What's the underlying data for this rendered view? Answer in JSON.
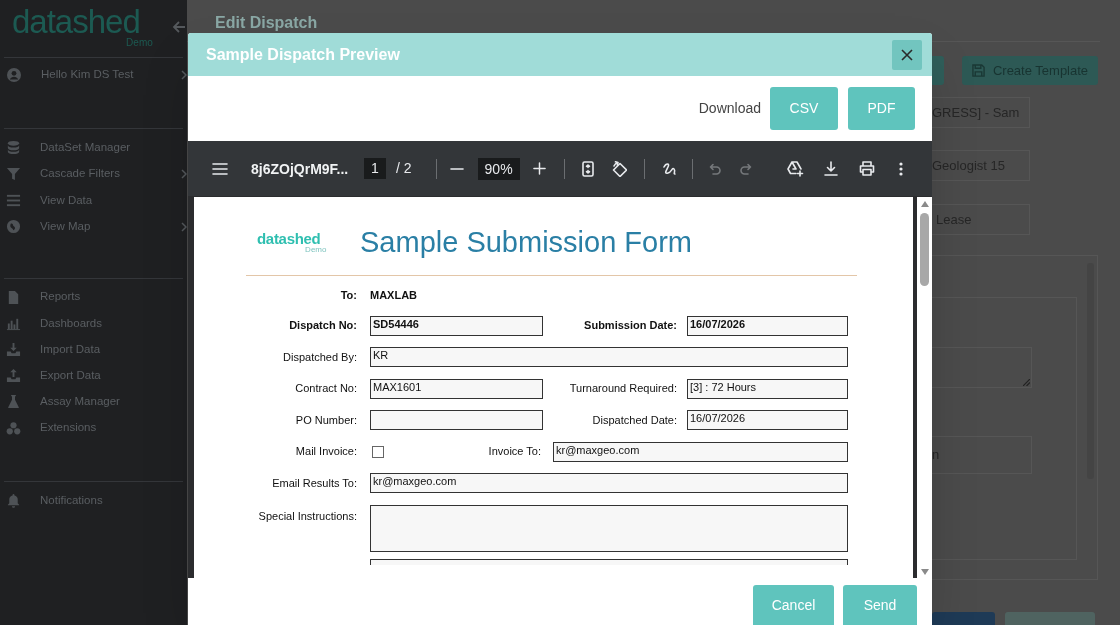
{
  "sidebar": {
    "logo": {
      "name": "datashed",
      "tag": "Demo"
    },
    "user": {
      "label": "Hello Kim DS Test",
      "has_submenu": true
    },
    "groups": [
      {
        "items": [
          {
            "label": "DataSet Manager",
            "has_submenu": false
          },
          {
            "label": "Cascade Filters",
            "has_submenu": true
          },
          {
            "label": "View Data",
            "has_submenu": false
          },
          {
            "label": "View Map",
            "has_submenu": true
          }
        ]
      },
      {
        "items": [
          {
            "label": "Reports",
            "has_submenu": false
          },
          {
            "label": "Dashboards",
            "has_submenu": false
          },
          {
            "label": "Import Data",
            "has_submenu": false
          },
          {
            "label": "Export Data",
            "has_submenu": false
          },
          {
            "label": "Assay Manager",
            "has_submenu": false
          },
          {
            "label": "Extensions",
            "has_submenu": false
          }
        ]
      },
      {
        "items": [
          {
            "label": "Notifications",
            "has_submenu": false
          }
        ]
      }
    ]
  },
  "page": {
    "title": "Edit Dispatch",
    "create_template_button": "Create Template",
    "fields": [
      "GRESS] - Sam",
      "Geologist 15",
      "Lease"
    ],
    "panel_field": "n"
  },
  "dialog": {
    "title": "Sample Dispatch Preview",
    "download_label": "Download",
    "download_buttons": [
      "CSV",
      "PDF"
    ],
    "viewer": {
      "file_name": "8j6ZOjQrM9F...",
      "page_input": "1",
      "page_total": "/ 2",
      "zoom": "90%",
      "history": [
        {
          "kind": "undo",
          "disabled": true
        },
        {
          "kind": "redo",
          "disabled": true
        }
      ]
    },
    "document": {
      "logo": {
        "name": "datashed",
        "tag": "Demo"
      },
      "title": "Sample Submission Form",
      "rows": [
        {
          "kind": "plain",
          "label": "To:",
          "value": "MAXLAB",
          "bold": true
        },
        {
          "kind": "pair",
          "fields": [
            {
              "label": "Dispatch No:",
              "value": "SD54446",
              "bold": true
            },
            {
              "label": "Submission Date:",
              "value": "16/07/2026",
              "bold": true
            }
          ]
        },
        {
          "kind": "wide",
          "label": "Dispatched By:",
          "value": "KR",
          "bold": false
        },
        {
          "kind": "pair",
          "fields": [
            {
              "label": "Contract No:",
              "value": "MAX1601",
              "bold": false
            },
            {
              "label": "Turnaround Required:",
              "value": "[3] : 72 Hours",
              "bold": false
            }
          ]
        },
        {
          "kind": "pair",
          "fields": [
            {
              "label": "PO Number:",
              "bold": false
            },
            {
              "label": "Dispatched Date:",
              "value": "16/07/2026",
              "bold": false
            }
          ]
        },
        {
          "kind": "checkbox_pair",
          "checkbox": {
            "label": "Mail Invoice:",
            "checked": false
          },
          "field": {
            "label": "Invoice To:",
            "value": "kr@maxgeo.com"
          }
        },
        {
          "kind": "wide",
          "label": "Email Results To:",
          "value": "kr@maxgeo.com",
          "bold": false
        },
        {
          "kind": "area",
          "label": "Special Instructions:"
        },
        {
          "kind": "partial"
        }
      ]
    },
    "buttons": [
      "Cancel",
      "Send"
    ]
  }
}
